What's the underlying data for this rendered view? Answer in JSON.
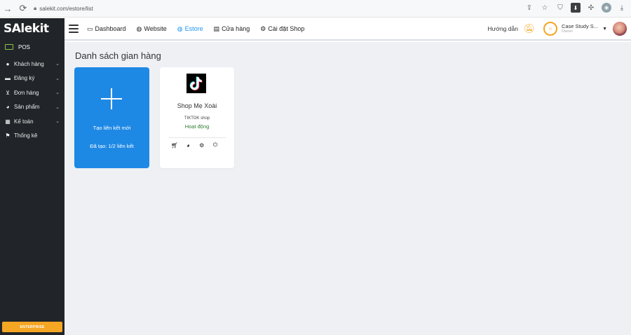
{
  "browser": {
    "url": "salekit.com/estore/list",
    "back_icon": "arrow-left-icon",
    "forward_icon": "arrow-right-icon",
    "reload_icon": "reload-icon"
  },
  "sidebar": {
    "logo": "SAlekit",
    "pos_label": "POS",
    "items": [
      {
        "label": "Khách hàng",
        "icon": "user-icon"
      },
      {
        "label": "Đăng ký",
        "icon": "ticket-icon"
      },
      {
        "label": "Đơn hàng",
        "icon": "cart-icon"
      },
      {
        "label": "Sản phẩm",
        "icon": "product-icon"
      },
      {
        "label": "Kế toán",
        "icon": "calculator-icon"
      },
      {
        "label": "Thống kê",
        "icon": "flag-icon"
      }
    ],
    "enterprise_label": "ENTERPRISE"
  },
  "topnav": {
    "links": [
      {
        "label": "Dashboard",
        "icon": "monitor-icon"
      },
      {
        "label": "Website",
        "icon": "globe-icon"
      },
      {
        "label": "Estore",
        "icon": "globe-icon"
      },
      {
        "label": "Cửa hàng",
        "icon": "store-icon"
      },
      {
        "label": "Cài đặt Shop",
        "icon": "gear-icon"
      }
    ],
    "guide_label": "Hướng dẫn",
    "account_name": "Case Study S...",
    "account_role": "Owner"
  },
  "main": {
    "title": "Danh sách gian hàng",
    "create_card": {
      "label": "Tạo liên kết mới",
      "count": "Đã tạo: 1/2 liên kết"
    },
    "shops": [
      {
        "name": "Shop Mẹ Xoài",
        "type": "TIKTOK shop",
        "status": "Hoạt động"
      }
    ]
  },
  "colors": {
    "sidebar_bg": "#212529",
    "accent_blue": "#1e88e5",
    "status_green": "#2e7d32",
    "enterprise_orange": "#f5a623",
    "main_bg": "#eef0f4"
  }
}
